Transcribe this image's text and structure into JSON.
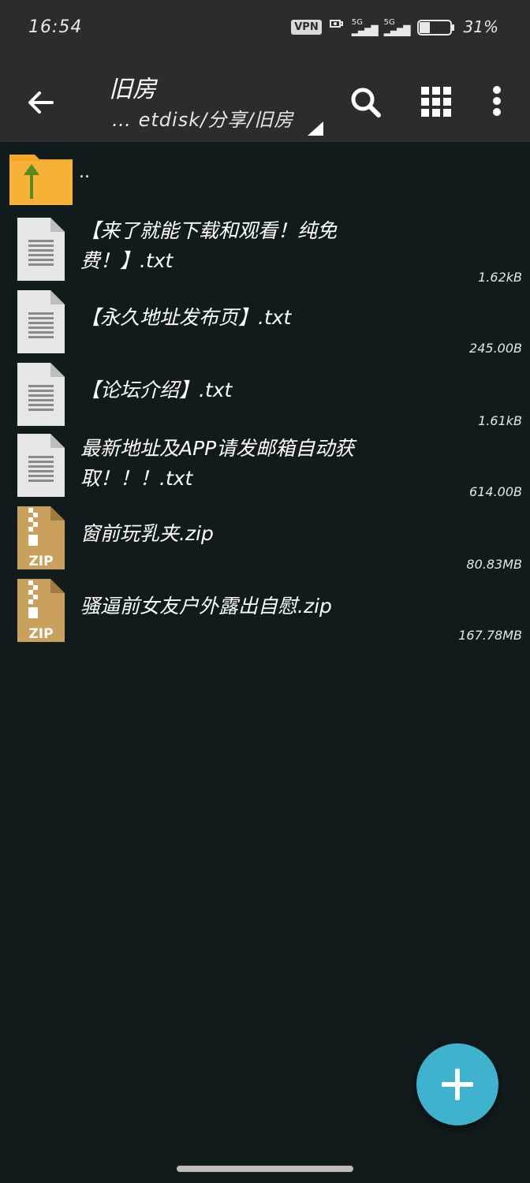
{
  "status_bar": {
    "time": "16:54",
    "vpn_label": "VPN",
    "sim1_label": "5G",
    "sim2_label": "5G",
    "battery_percent": "31%"
  },
  "app_bar": {
    "title": "旧房",
    "path": "… etdisk/分享/旧房"
  },
  "parent_dir": {
    "label": ".."
  },
  "files": [
    {
      "name": "【来了就能下载和观看！纯免费！】.txt",
      "size": "1.62kB",
      "type": "txt"
    },
    {
      "name": "【永久地址发布页】.txt",
      "size": "245.00B",
      "type": "txt"
    },
    {
      "name": "【论坛介绍】.txt",
      "size": "1.61kB",
      "type": "txt"
    },
    {
      "name": "最新地址及APP请发邮箱自动获取！！！.txt",
      "size": "614.00B",
      "type": "txt"
    },
    {
      "name": "窗前玩乳夹.zip",
      "size": "80.83MB",
      "type": "zip"
    },
    {
      "name": "骚逼前女友户外露出自慰.zip",
      "size": "167.78MB",
      "type": "zip"
    }
  ],
  "zip_badge": "ZIP",
  "colors": {
    "background": "#121b1b",
    "appbar": "#2c2c2c",
    "fab": "#3fb2cd",
    "folder": "#f5a623",
    "zip_icon": "#c9a05c"
  }
}
